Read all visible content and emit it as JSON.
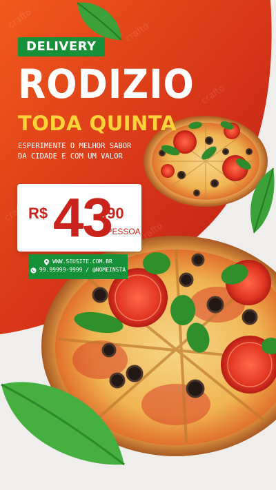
{
  "badge": "DELIVERY",
  "title": "RODIZIO",
  "subtitle": "TODA QUINTA",
  "description_line1": "ESPERIMENTE O MELHOR SABOR",
  "description_line2": "DA CIDADE E COM UM VALOR",
  "price": {
    "currency": "R$",
    "amount": "43",
    "cents": ",90",
    "per": "/PESSOA"
  },
  "contact": {
    "website": "WWW.SEUSITE.COM.BR",
    "phone_social": "99.99999-9999 / @NOMEINSTA",
    "location_icon": "location-pin-icon",
    "whatsapp_icon": "whatsapp-icon"
  },
  "colors": {
    "red": "#c9231c",
    "orange": "#e8501c",
    "green": "#16913a",
    "yellow": "#ffd23a",
    "background": "#efeeec"
  },
  "watermark": "crafto"
}
